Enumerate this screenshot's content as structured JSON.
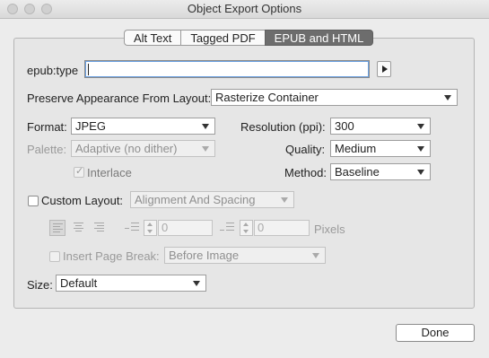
{
  "window": {
    "title": "Object Export Options"
  },
  "tabs": [
    {
      "label": "Alt Text",
      "active": false
    },
    {
      "label": "Tagged PDF",
      "active": false
    },
    {
      "label": "EPUB and HTML",
      "active": true
    }
  ],
  "epub_type": {
    "label": "epub:type",
    "value": ""
  },
  "preserve": {
    "label": "Preserve Appearance From Layout:",
    "value": "Rasterize Container"
  },
  "format": {
    "label": "Format:",
    "value": "JPEG"
  },
  "resolution": {
    "label": "Resolution (ppi):",
    "value": "300"
  },
  "palette": {
    "label": "Palette:",
    "value": "Adaptive (no dither)"
  },
  "quality": {
    "label": "Quality:",
    "value": "Medium"
  },
  "interlace": {
    "label": "Interlace",
    "checked": true
  },
  "method": {
    "label": "Method:",
    "value": "Baseline"
  },
  "custom_layout": {
    "label": "Custom Layout:",
    "checked": false,
    "value": "Alignment And Spacing"
  },
  "spacing": {
    "before_value": "0",
    "after_value": "0",
    "unit": "Pixels"
  },
  "page_break": {
    "label": "Insert Page Break:",
    "checked": false,
    "value": "Before Image"
  },
  "size": {
    "label": "Size:",
    "value": "Default"
  },
  "done_label": "Done",
  "icons": [
    "close-icon",
    "minimize-icon",
    "zoom-icon",
    "arrow-right-icon",
    "align-left-icon",
    "align-center-icon",
    "align-right-icon",
    "space-before-icon",
    "space-after-icon",
    "chevron-down-icon",
    "checkmark-icon"
  ]
}
